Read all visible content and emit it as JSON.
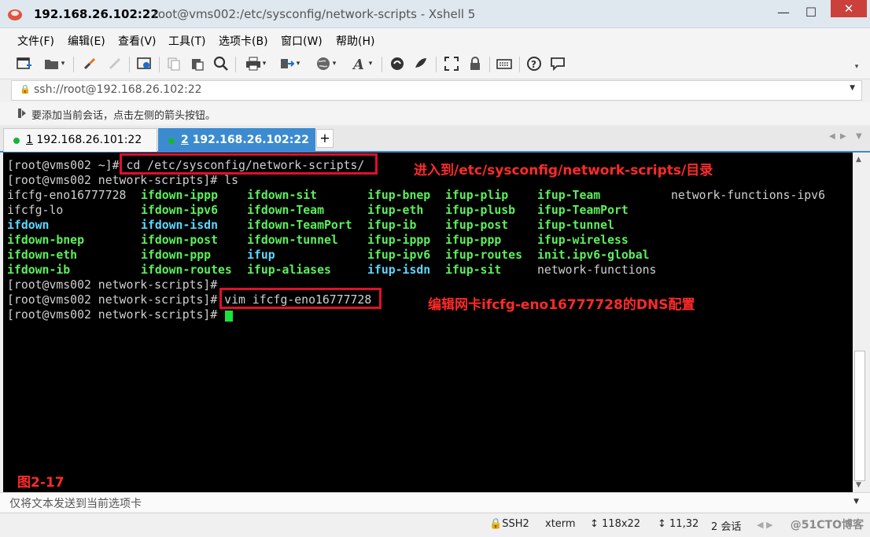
{
  "window": {
    "host_title": "192.168.26.102:22",
    "title_rest": "root@vms002:/etc/sysconfig/network-scripts - Xshell 5",
    "minimize": "—",
    "maximize": "☐",
    "close": "✕",
    "accent": "#3c8bd0"
  },
  "menu": [
    "文件(F)",
    "编辑(E)",
    "查看(V)",
    "工具(T)",
    "选项卡(B)",
    "窗口(W)",
    "帮助(H)"
  ],
  "address": {
    "value": "ssh://root@192.168.26.102:22"
  },
  "hint": {
    "text": "要添加当前会话，点击左侧的箭头按钮。"
  },
  "tabs": [
    {
      "num": "1",
      "label": "192.168.26.101:22",
      "active": false
    },
    {
      "num": "2",
      "label": "192.168.26.102:22",
      "active": true
    }
  ],
  "tab_add": "+",
  "terminal": {
    "line1_prompt": "[root@vms002 ~]#",
    "line1_cmd": " cd /etc/sysconfig/network-scripts/",
    "line2": "[root@vms002 network-scripts]# ls",
    "ls_columns": [
      [
        {
          "t": "ifcfg-eno16777728",
          "c": "plain"
        },
        {
          "t": "ifcfg-lo",
          "c": "plain"
        },
        {
          "t": "ifdown",
          "c": "cyan"
        },
        {
          "t": "ifdown-bnep",
          "c": "green"
        },
        {
          "t": "ifdown-eth",
          "c": "green"
        },
        {
          "t": "ifdown-ib",
          "c": "green"
        }
      ],
      [
        {
          "t": "ifdown-ippp",
          "c": "green"
        },
        {
          "t": "ifdown-ipv6",
          "c": "green"
        },
        {
          "t": "ifdown-isdn",
          "c": "cyan"
        },
        {
          "t": "ifdown-post",
          "c": "green"
        },
        {
          "t": "ifdown-ppp",
          "c": "green"
        },
        {
          "t": "ifdown-routes",
          "c": "green"
        }
      ],
      [
        {
          "t": "ifdown-sit",
          "c": "green"
        },
        {
          "t": "ifdown-Team",
          "c": "green"
        },
        {
          "t": "ifdown-TeamPort",
          "c": "green"
        },
        {
          "t": "ifdown-tunnel",
          "c": "green"
        },
        {
          "t": "ifup",
          "c": "cyan"
        },
        {
          "t": "ifup-aliases",
          "c": "green"
        }
      ],
      [
        {
          "t": "ifup-bnep",
          "c": "green"
        },
        {
          "t": "ifup-eth",
          "c": "green"
        },
        {
          "t": "ifup-ib",
          "c": "green"
        },
        {
          "t": "ifup-ippp",
          "c": "green"
        },
        {
          "t": "ifup-ipv6",
          "c": "green"
        },
        {
          "t": "ifup-isdn",
          "c": "cyan"
        }
      ],
      [
        {
          "t": "ifup-plip",
          "c": "green"
        },
        {
          "t": "ifup-plusb",
          "c": "green"
        },
        {
          "t": "ifup-post",
          "c": "green"
        },
        {
          "t": "ifup-ppp",
          "c": "green"
        },
        {
          "t": "ifup-routes",
          "c": "green"
        },
        {
          "t": "ifup-sit",
          "c": "green"
        }
      ],
      [
        {
          "t": "ifup-Team",
          "c": "green"
        },
        {
          "t": "ifup-TeamPort",
          "c": "green"
        },
        {
          "t": "ifup-tunnel",
          "c": "green"
        },
        {
          "t": "ifup-wireless",
          "c": "green"
        },
        {
          "t": "init.ipv6-global",
          "c": "green"
        },
        {
          "t": "network-functions",
          "c": "plain"
        }
      ],
      [
        {
          "t": "network-functions-ipv6",
          "c": "plain"
        }
      ]
    ],
    "line9": "[root@vms002 network-scripts]#",
    "line10_prompt": "[root@vms002 network-scripts]#",
    "line10_cmd": " vim ifcfg-eno16777728",
    "line11": "[root@vms002 network-scripts]#",
    "annotation1": "进入到/etc/sysconfig/network-scripts/目录",
    "annotation2": "编辑网卡ifcfg-eno16777728的DNS配置",
    "figure_label": "图2-17"
  },
  "sendbar": {
    "text": "仅将文本发送到当前选项卡"
  },
  "status": {
    "protocol": "SSH2",
    "term": "xterm",
    "size": "118x22",
    "cursor_pos": "11,32",
    "sessions": "2 会话",
    "watermark": "@51CTO博客"
  }
}
